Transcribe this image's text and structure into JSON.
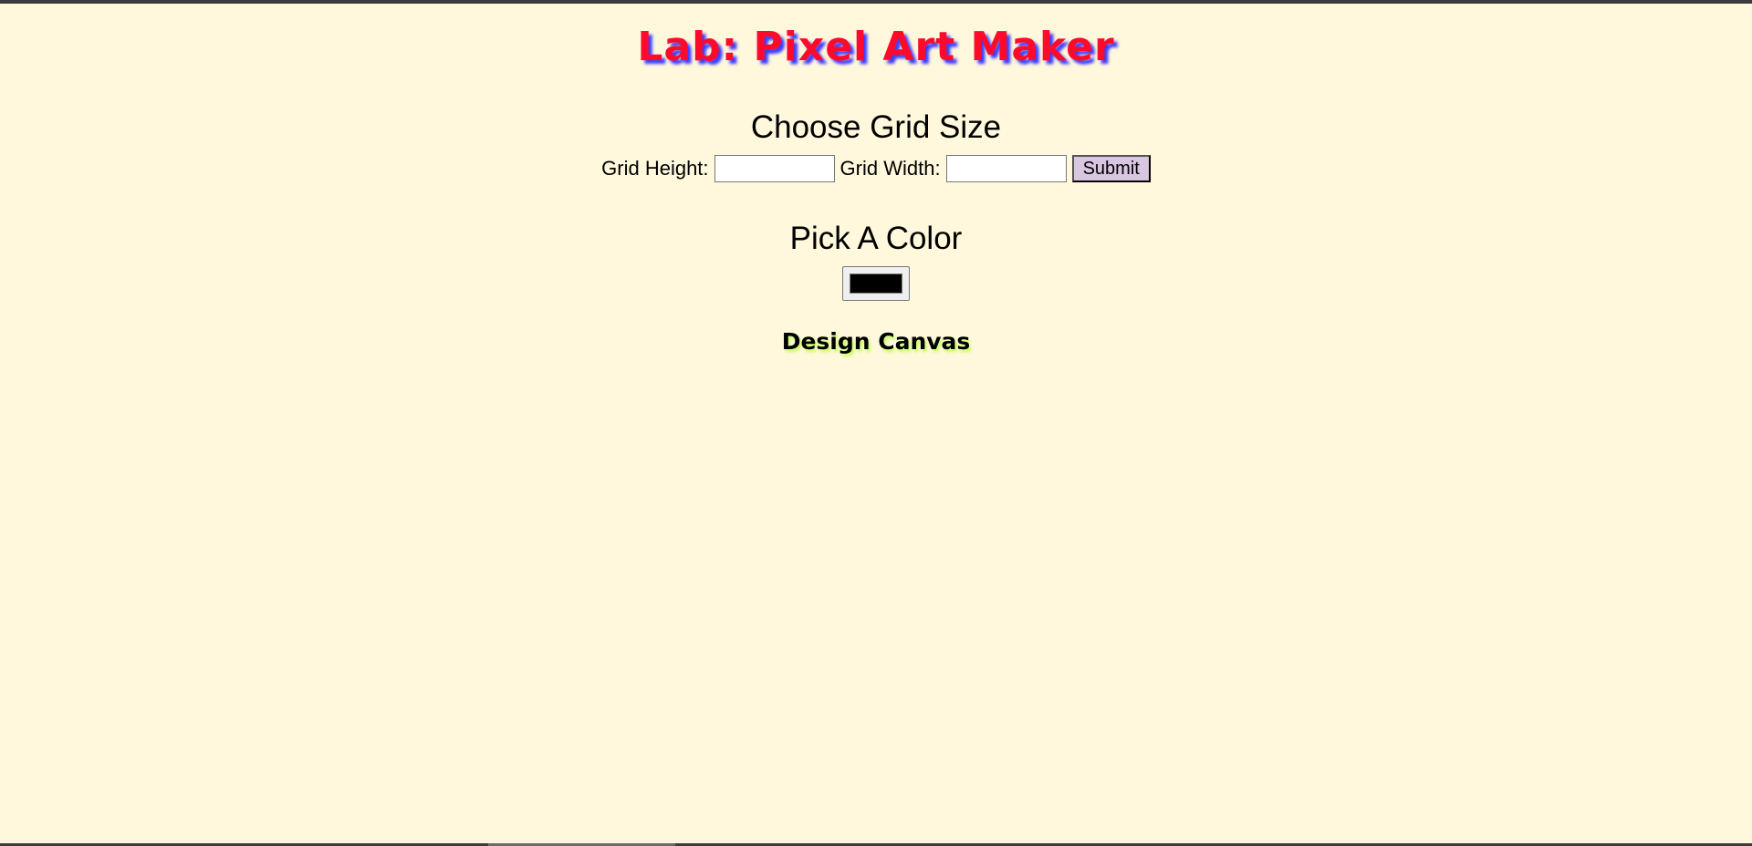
{
  "page": {
    "title": "Lab: Pixel Art Maker",
    "background_color": "#fff8dc",
    "title_color": "#ff0a2a",
    "title_shadow_color": "#3c3cff"
  },
  "grid_size": {
    "heading": "Choose Grid Size",
    "height_label": "Grid Height:",
    "height_value": "",
    "width_label": "Grid Width:",
    "width_value": "",
    "submit_label": "Submit",
    "submit_color": "#d9c6e0"
  },
  "color": {
    "heading": "Pick A Color",
    "value": "#000000"
  },
  "canvas": {
    "heading": "Design Canvas",
    "heading_shadow_color": "#c6ff5a"
  }
}
